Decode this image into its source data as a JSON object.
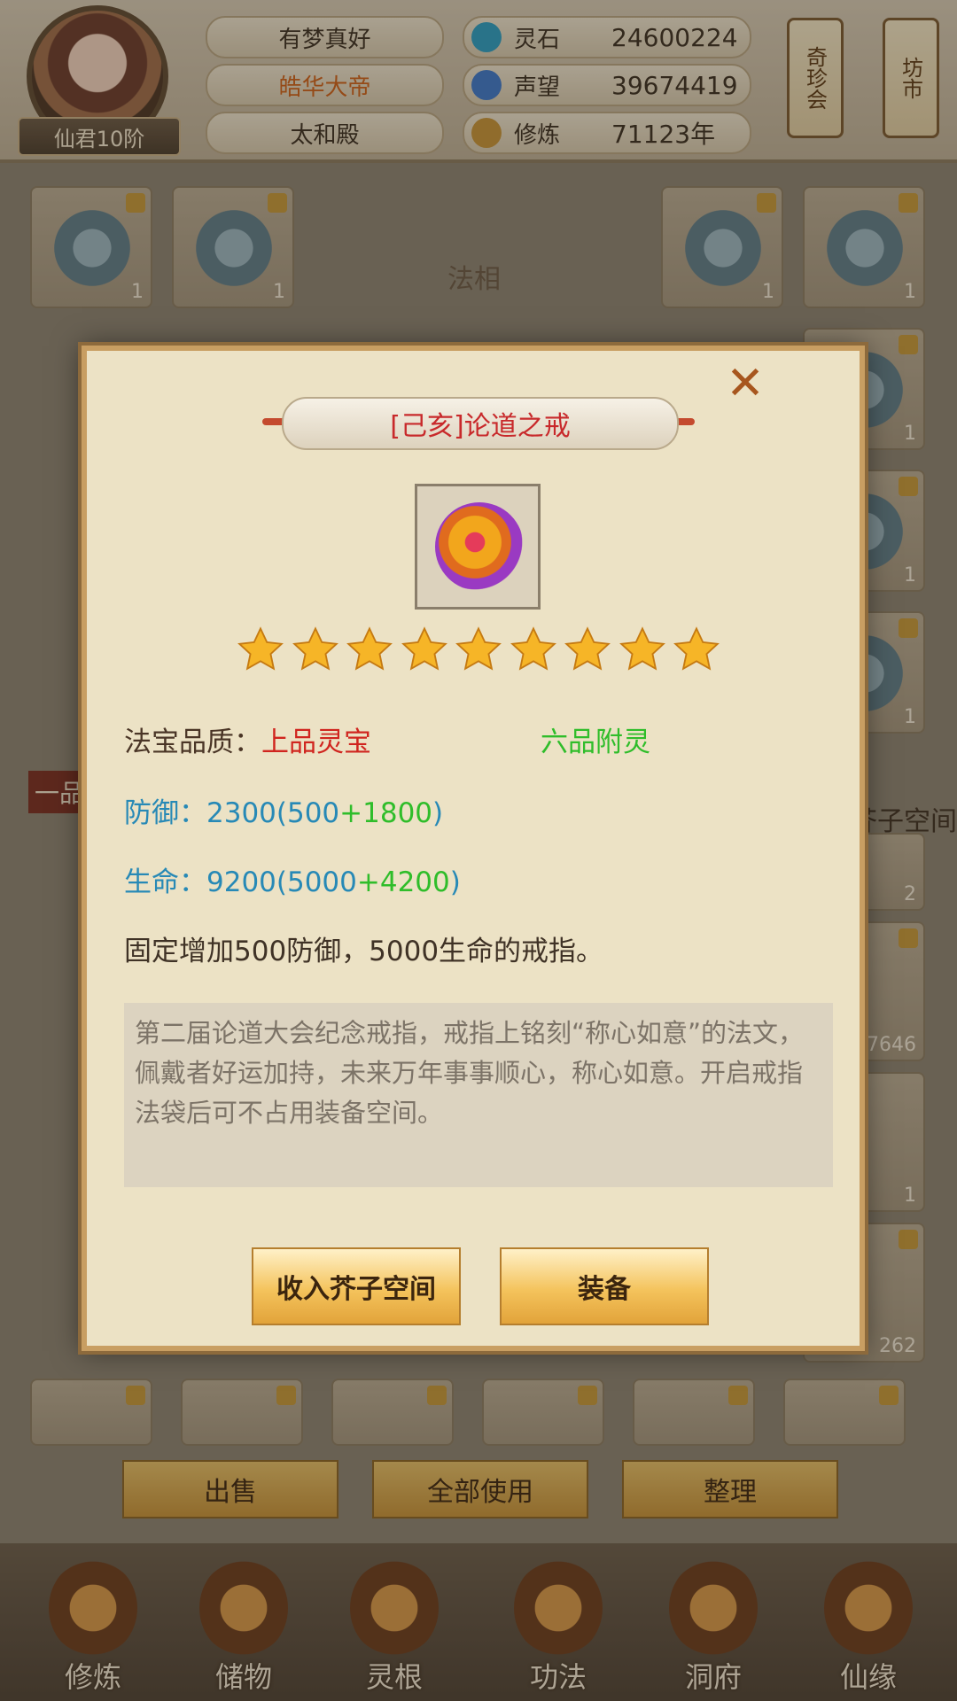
{
  "player": {
    "rank": "仙君10阶",
    "names": [
      "有梦真好",
      "皓华大帝",
      "太和殿"
    ],
    "stats": [
      {
        "icon": "spirit-stone-icon",
        "label": "灵石",
        "value": "24600224",
        "color": "#2aa0c8"
      },
      {
        "icon": "reputation-crystal-icon",
        "label": "声望",
        "value": "39674419",
        "color": "#3c7ad0"
      },
      {
        "icon": "meditation-icon",
        "label": "修炼",
        "value": "71123年",
        "color": "#c8963a"
      }
    ]
  },
  "top_buttons": {
    "qizhenhui": "奇珍会",
    "fangshi": "坊市"
  },
  "background": {
    "faxiang_label": "法相",
    "first_grade_tab": "一品",
    "space_label": "芥子空间",
    "slot_counts": [
      "1",
      "1",
      "1",
      "1",
      "1",
      "1",
      "1",
      "2",
      "7646",
      "1",
      "262"
    ]
  },
  "bottom_buttons": [
    "出售",
    "全部使用",
    "整理"
  ],
  "bottom_nav": [
    "修炼",
    "储物",
    "灵根",
    "功法",
    "洞府",
    "仙缘"
  ],
  "dialog": {
    "title": "[己亥]论道之戒",
    "close": "✕",
    "stars": 9,
    "quality_label": "法宝品质：",
    "quality_value": "上品灵宝",
    "attach_spirit": "六品附灵",
    "defense_label": "防御：",
    "defense_base": "2300(500",
    "defense_bonus": "+1800",
    "defense_close": ")",
    "life_label": "生命：",
    "life_base": "9200(5000",
    "life_bonus": "+4200",
    "life_close": ")",
    "effect": "固定增加500防御，5000生命的戒指。",
    "description": "第二届论道大会纪念戒指，戒指上铭刻“称心如意”的法文，佩戴者好运加持，未来万年事事顺心，称心如意。开启戒指法袋后可不占用装备空间。",
    "btn_store": "收入芥子空间",
    "btn_equip": "装备"
  }
}
